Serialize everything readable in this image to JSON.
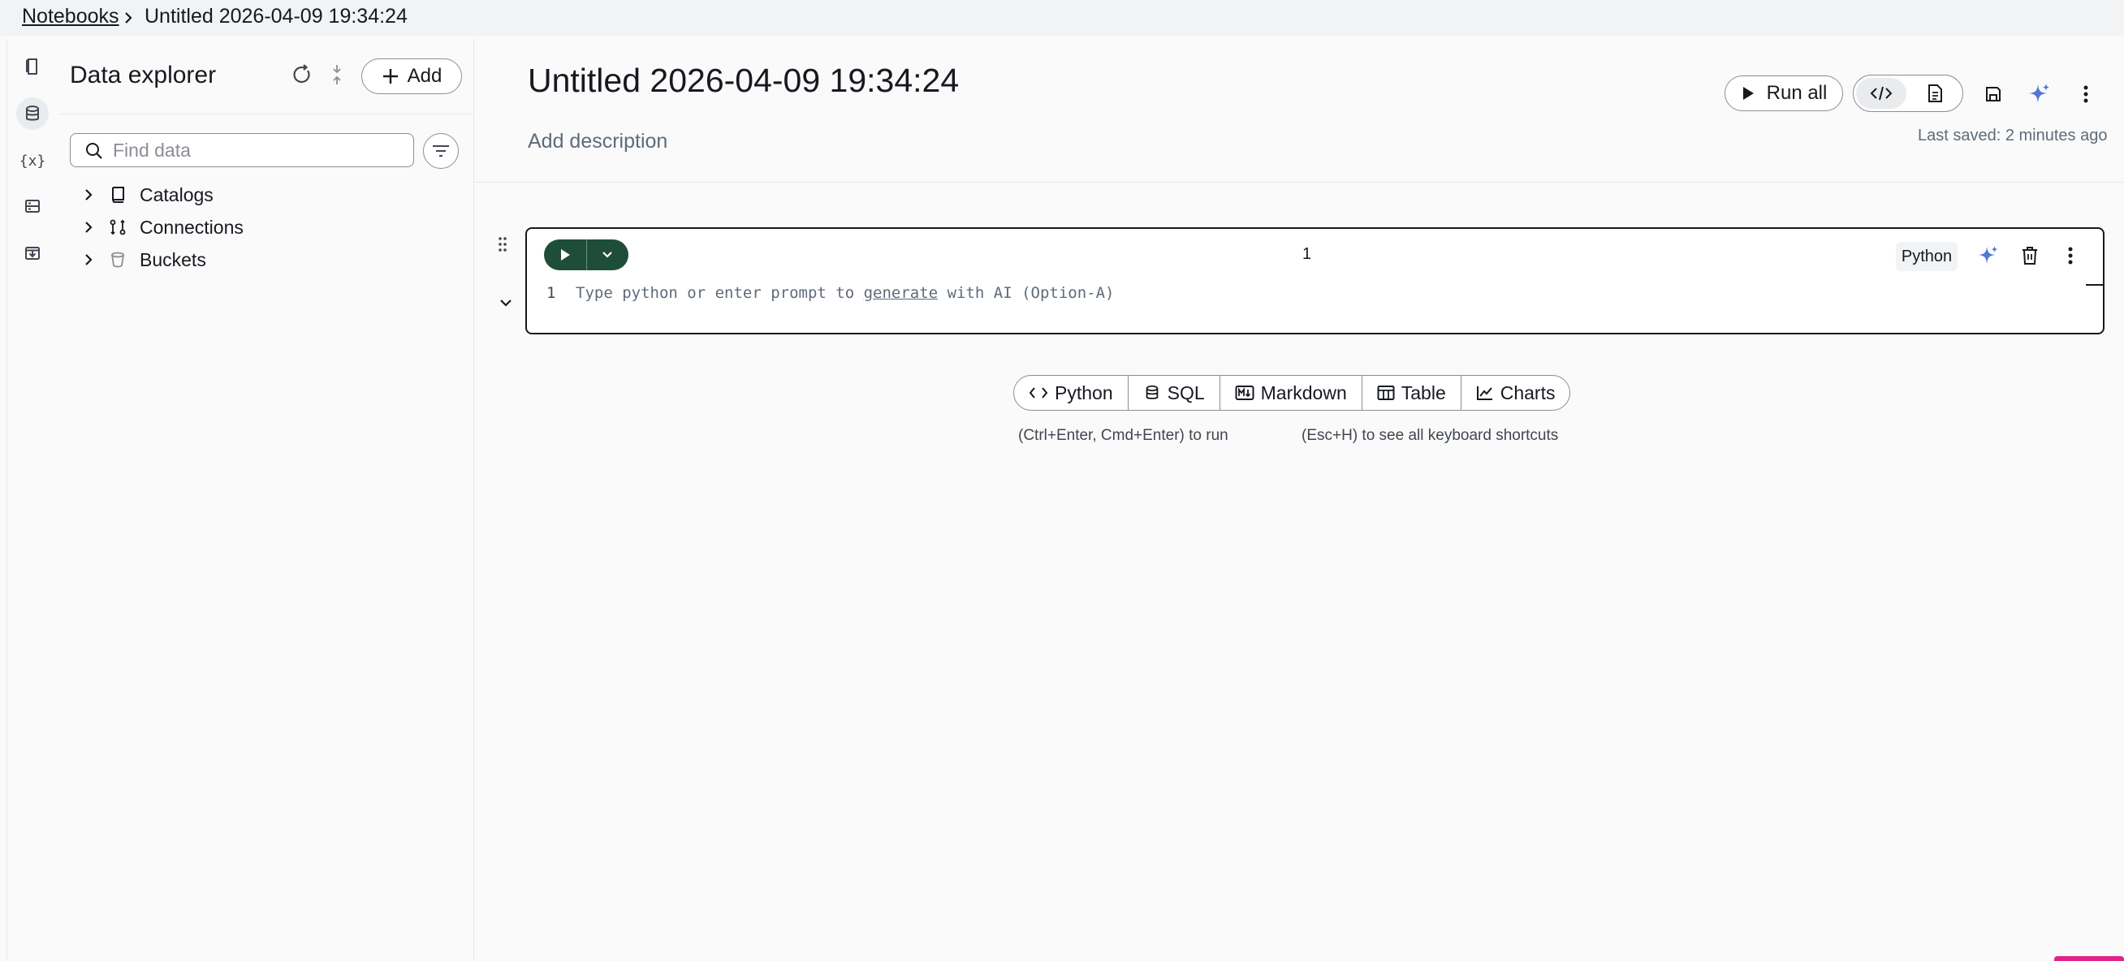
{
  "breadcrumb": {
    "parent_label": "Notebooks",
    "current_label": "Untitled 2026-04-09 19:34:24"
  },
  "rail": {
    "items": [
      {
        "name": "notebook",
        "icon": "notebook-icon"
      },
      {
        "name": "data",
        "icon": "database-icon",
        "active": true
      },
      {
        "name": "variables",
        "icon": "variables-icon",
        "label": "{x}"
      },
      {
        "name": "storage",
        "icon": "storage-icon"
      },
      {
        "name": "export",
        "icon": "export-icon"
      }
    ]
  },
  "explorer": {
    "title": "Data explorer",
    "add_label": "Add",
    "search_placeholder": "Find data",
    "tree": [
      {
        "label": "Catalogs",
        "icon": "book-icon"
      },
      {
        "label": "Connections",
        "icon": "connections-icon"
      },
      {
        "label": "Buckets",
        "icon": "bucket-icon"
      }
    ]
  },
  "notebook": {
    "title": "Untitled 2026-04-09 19:34:24",
    "description_placeholder": "Add description",
    "run_all_label": "Run all",
    "last_saved": "Last saved: 2 minutes ago",
    "view_mode": "code"
  },
  "cell": {
    "execution_count": "1",
    "language": "Python",
    "line_number": "1",
    "placeholder_before": "Type python or enter prompt to ",
    "placeholder_link": "generate",
    "placeholder_after": " with AI (Option-A)"
  },
  "add_cell": {
    "options": [
      "Python",
      "SQL",
      "Markdown",
      "Table",
      "Charts"
    ],
    "hint_run": "(Ctrl+Enter, Cmd+Enter) to run",
    "hint_shortcuts": "(Esc+H) to see all keyboard shortcuts"
  },
  "colors": {
    "run_button": "#1e4d3a",
    "ai_sparkle": "#5277d9",
    "corner_accent": "#e0218a"
  }
}
